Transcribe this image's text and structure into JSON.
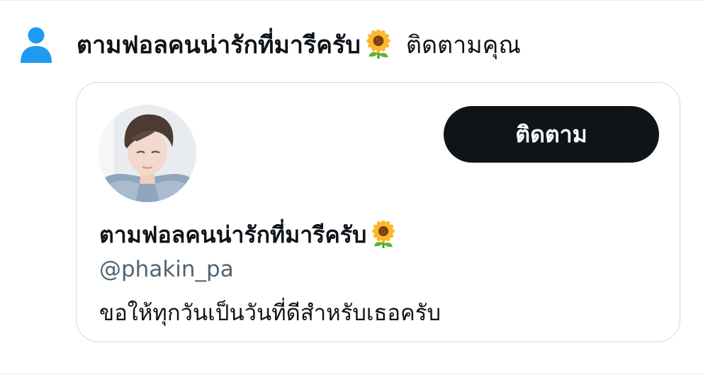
{
  "notification": {
    "follower_name": "ตามฟอลคนน่ารักที่มารีครับ",
    "action_text": "ติดตามคุณ",
    "icon": "person-icon",
    "icon_color": "#1d9bf0"
  },
  "user_card": {
    "display_name": "ตามฟอลคนน่ารักที่มารีครับ",
    "name_emoji": "sunflower-emoji",
    "handle": "@phakin_pa",
    "bio": "ขอให้ทุกวันเป็นวันที่ดีสำหรับเธอครับ",
    "follow_button_label": "ติดตาม",
    "button_color": "#0f1419"
  }
}
